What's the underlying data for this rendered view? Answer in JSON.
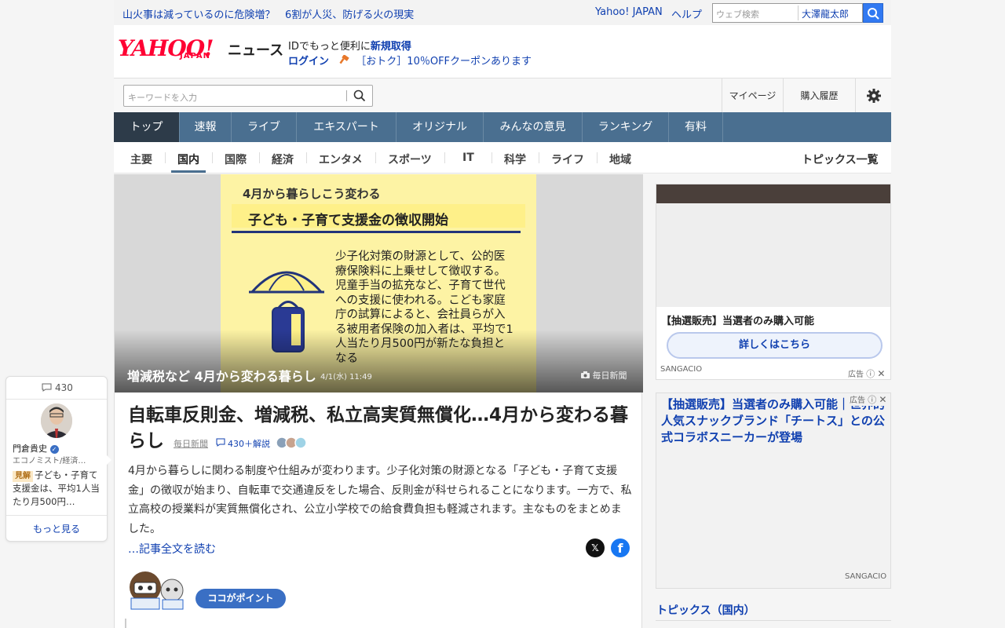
{
  "topbar": {
    "headline_link1": "山火事は減っているのに危険増？",
    "headline_link2": "6割が人災、防げる火の現実",
    "yahoo_japan": "Yahoo! JAPAN",
    "help": "ヘルプ",
    "web_search_placeholder": "ウェブ検索",
    "user_name": "大澤龍太郎"
  },
  "header": {
    "logo": "YAHOO!",
    "logo_sub": "JAPAN",
    "news": "ニュース",
    "id_text": "IDでもっと便利に",
    "signup": "新規取得",
    "login": "ログイン",
    "coupon": "［おトク］10％OFFクーポンあります"
  },
  "search_row": {
    "placeholder": "キーワードを入力",
    "mypage": "マイページ",
    "history": "購入履歴"
  },
  "nav": [
    "トップ",
    "速報",
    "ライブ",
    "エキスパート",
    "オリジナル",
    "みんなの意見",
    "ランキング",
    "有料"
  ],
  "subnav": {
    "items": [
      "主要",
      "国内",
      "国際",
      "経済",
      "エンタメ",
      "スポーツ",
      "IT",
      "科学",
      "ライフ",
      "地域"
    ],
    "all_topics": "トピックス一覧"
  },
  "hero": {
    "caption": "増減税など 4月から変わる暮らし",
    "date": "4/1(水) 11:49",
    "source": "毎日新聞",
    "img_header": "4月から暮らしこう変わる",
    "img_title": "子ども・子育て支援金の徴収開始",
    "img_body": "少子化対策の財源として、公的医療保険料に上乗せして徴収する。児童手当の拡充など、子育て世代への支援に使われる。こども家庭庁の試算によると、会社員らが入る被用者保険の加入者は、平均で1人当たり月500円が新たな負担となる"
  },
  "article": {
    "title": "自転車反則金、増減税、私立高実質無償化…4月から変わる暮らし",
    "source": "毎日新聞",
    "comments": "430＋解説",
    "body": "4月から暮らしに関わる制度や仕組みが変わります。少子化対策の財源となる「子ども・子育て支援金」の徴収が始まり、自転車で交通違反をした場合、反則金が科せられることになります。一方で、私立高校の授業料が実質無償化され、公立小学校での給食費負担も軽減されます。主なものをまとめました。",
    "read_more": "…記事全文を読む",
    "point_badge": "ココがポイント"
  },
  "ads": {
    "ad1_title": "【抽選販売】当選者のみ購入可能",
    "ad1_button": "詳しくはこちら",
    "ad1_sponsor": "SANGACIO",
    "ad_label": "広告",
    "ad2_text": "【抽選販売】当選者のみ購入可能｜世界的人気スナックブランド「チートス」との公式コラボスニーカーが登場",
    "ad2_sponsor": "SANGACIO"
  },
  "topics": {
    "title": "トピックス（国内）"
  },
  "comment_card": {
    "count": "430",
    "name": "門倉貴史",
    "role": "エコノミスト/経済…",
    "tag": "見解",
    "text": "子ども・子育て支援金は、平均1人当たり月500円…",
    "more": "もっと見る"
  },
  "colors": {
    "nav_bg": "#4a6f90",
    "nav_active": "#2d3b49",
    "link": "#1040b0",
    "logo": "#ff0033"
  }
}
